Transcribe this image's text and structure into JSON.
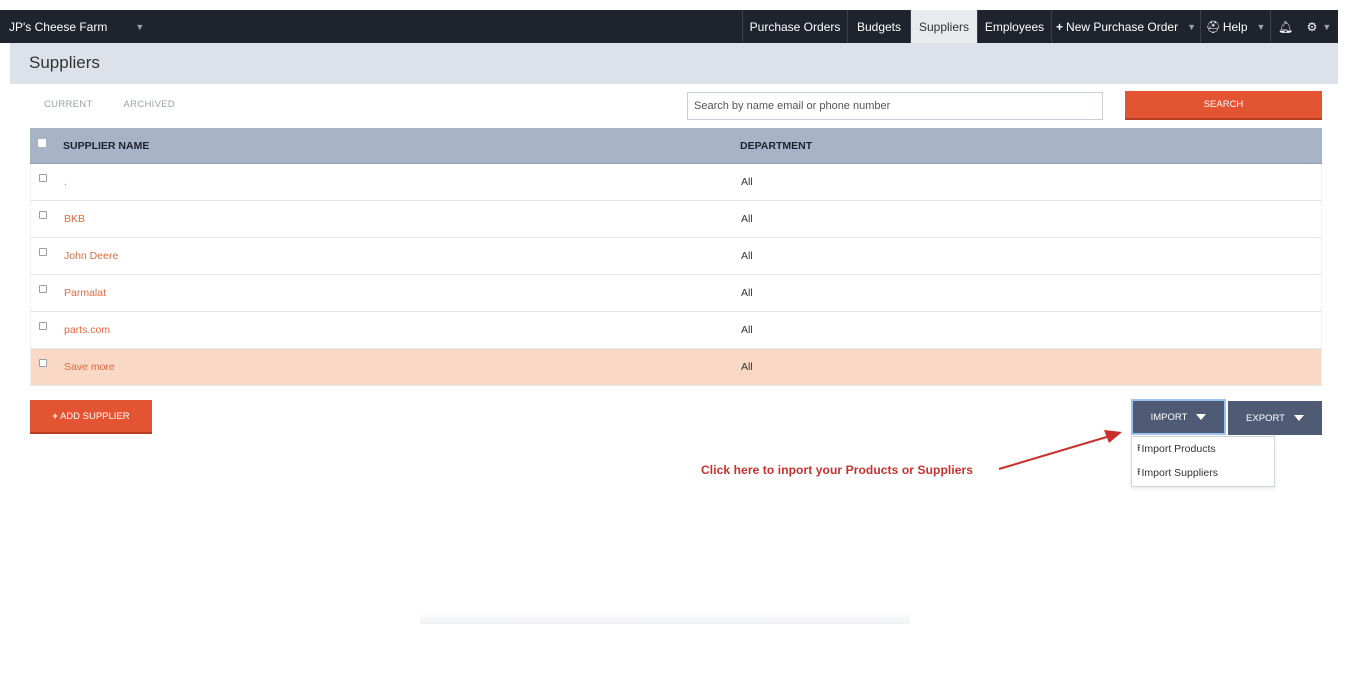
{
  "nav": {
    "brand": "JP's Cheese Farm",
    "items": [
      {
        "label": "Purchase Orders"
      },
      {
        "label": "Budgets"
      },
      {
        "label": "Suppliers"
      },
      {
        "label": "Employees"
      },
      {
        "label": "New Purchase Order"
      },
      {
        "label": "Help"
      }
    ],
    "active": "Suppliers"
  },
  "page": {
    "title": "Suppliers"
  },
  "tabs": {
    "current": "CURRENT",
    "archived": "ARCHIVED"
  },
  "search": {
    "placeholder": "Search by name email or phone number",
    "button": "SEARCH"
  },
  "table": {
    "headers": {
      "name": "SUPPLIER NAME",
      "department": "DEPARTMENT"
    },
    "rows": [
      {
        "name": ".",
        "department": "All"
      },
      {
        "name": "BKB",
        "department": "All"
      },
      {
        "name": "John Deere",
        "department": "All"
      },
      {
        "name": "Parmalat",
        "department": "All"
      },
      {
        "name": "parts.com",
        "department": "All"
      },
      {
        "name": "Save more",
        "department": "All"
      }
    ]
  },
  "actions": {
    "add_supplier": "ADD SUPPLIER",
    "import": "IMPORT",
    "export": "EXPORT",
    "import_menu": [
      "Import Products",
      "Import Suppliers"
    ]
  },
  "annotation": "Click here to inport your Products or Suppliers",
  "colors": {
    "accent": "#e35433",
    "nav_bg": "#1e232e",
    "table_header": "#a7b3c7",
    "highlight_row": "#f9d8c5",
    "annotation": "#c9302c"
  }
}
